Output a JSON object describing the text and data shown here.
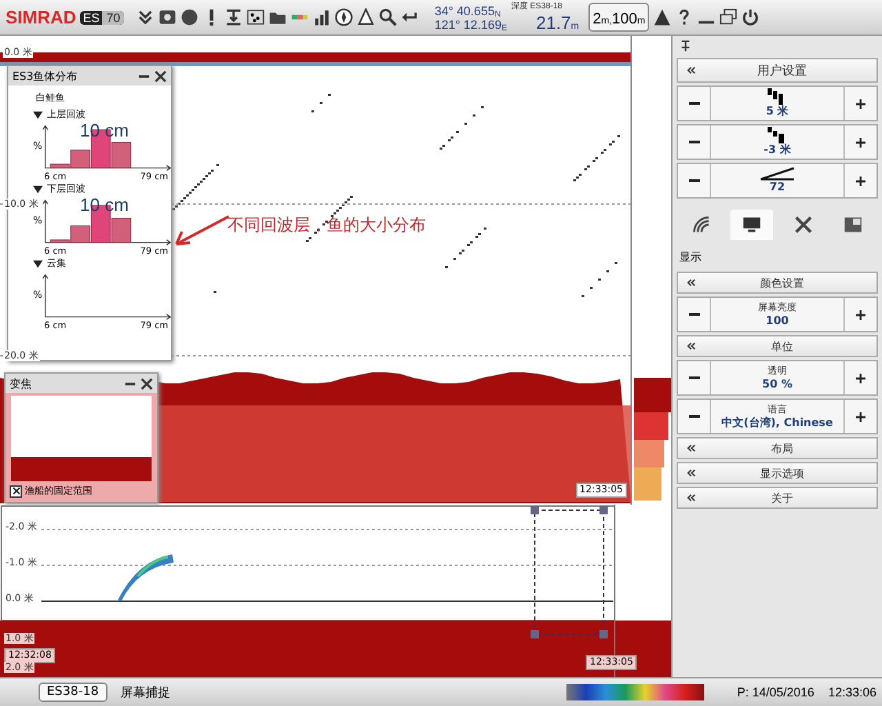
{
  "toolbar": {
    "brand": "SIMRAD",
    "model_prefix": "ES",
    "model": "70",
    "latitude": "34° 40.655",
    "lat_hemi": "N",
    "longitude": "121° 12.169",
    "lon_hemi": "E",
    "depth_label": "深度",
    "depth_source": "ES38-18",
    "depth_value": "21.7",
    "depth_unit": "m",
    "range_start": "2",
    "range_start_unit": "m,",
    "range_value": "100",
    "range_unit": "m"
  },
  "echogram": {
    "depth_labels": [
      "0.0 米",
      "10.0 米",
      "20.0 米"
    ],
    "time": "12:33:05"
  },
  "distribution_window": {
    "title": "ES3鱼体分布",
    "species": "白鲑鱼",
    "sections": [
      {
        "label": "上层回波",
        "expanded": true,
        "kind": "histogram",
        "peak": "10 cm",
        "y_label": "%",
        "x_min": "6 cm",
        "x_max": "79 cm"
      },
      {
        "label": "下层回波",
        "expanded": true,
        "kind": "histogram",
        "peak": "10 cm",
        "y_label": "%",
        "x_min": "6 cm",
        "x_max": "79 cm"
      },
      {
        "label": "云集",
        "expanded": true,
        "kind": "empty",
        "y_label": "%",
        "x_min": "6 cm",
        "x_max": "79 cm"
      }
    ]
  },
  "annotation": "不同回波层，鱼的大小分布",
  "zoom_window": {
    "title": "变焦",
    "checkbox": {
      "label": "渔船的固定范围",
      "checked": true
    }
  },
  "bottom_echogram": {
    "depth_labels": [
      "-2.0 米",
      "-1.0 米",
      "0.0 米",
      "1.0 米",
      "2.0 米"
    ],
    "time_start": "12:32:08",
    "time_end": "12:33:05"
  },
  "right_panel": {
    "header": "用户设置",
    "controls": [
      {
        "kind": "range",
        "value": "5 米"
      },
      {
        "kind": "start",
        "value": "-3 米"
      },
      {
        "kind": "slope",
        "value": "72"
      }
    ],
    "tabs": [
      {
        "selected": false
      },
      {
        "selected": true
      },
      {
        "selected": false
      },
      {
        "selected": false
      }
    ],
    "section_title": "显示",
    "items": [
      {
        "kind": "nav",
        "label": "颜色设置"
      },
      {
        "kind": "stepper",
        "label": "屏幕亮度",
        "value": "100"
      },
      {
        "kind": "nav",
        "label": "单位"
      },
      {
        "kind": "stepper",
        "label": "透明",
        "value": "50 %"
      },
      {
        "kind": "stepper",
        "label": "语言",
        "value": "中文(台湾), Chinese"
      },
      {
        "kind": "nav",
        "label": "布局"
      },
      {
        "kind": "nav",
        "label": "显示选项"
      },
      {
        "kind": "nav",
        "label": "关于"
      }
    ]
  },
  "status_bar": {
    "tabs": [
      {
        "label": "ES38-18",
        "selected": true
      },
      {
        "label": "屏幕捕捉",
        "selected": false
      }
    ],
    "date": "P: 14/05/2016",
    "time": "12:33:06"
  }
}
